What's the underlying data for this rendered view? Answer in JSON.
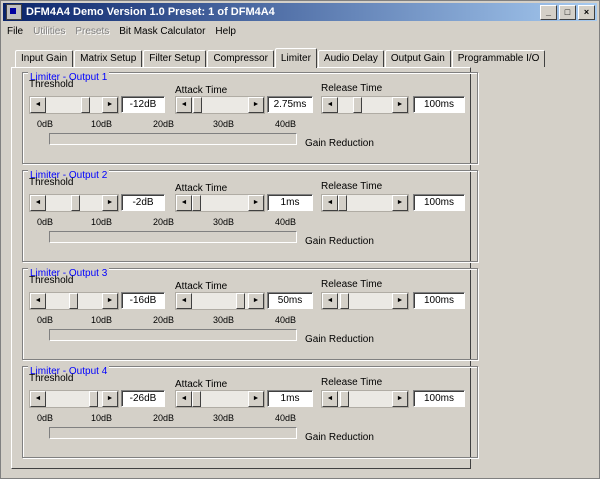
{
  "window": {
    "title": "DFM4A4 Demo Version 1.0 Preset: 1 of DFM4A4",
    "min_label": "_",
    "max_label": "□",
    "close_label": "×"
  },
  "menu": [
    {
      "label": "File",
      "enabled": true
    },
    {
      "label": "Utilities",
      "enabled": false
    },
    {
      "label": "Presets",
      "enabled": false
    },
    {
      "label": "Bit Mask Calculator",
      "enabled": true
    },
    {
      "label": "Help",
      "enabled": true
    }
  ],
  "tabs": [
    {
      "label": "Input Gain"
    },
    {
      "label": "Matrix Setup"
    },
    {
      "label": "Filter Setup"
    },
    {
      "label": "Compressor"
    },
    {
      "label": "Limiter"
    },
    {
      "label": "Audio Delay"
    },
    {
      "label": "Output Gain"
    },
    {
      "label": "Programmable I/O"
    }
  ],
  "active_tab": "Limiter",
  "labels": {
    "threshold": "Threshold",
    "attack_time": "Attack Time",
    "release_time": "Release Time",
    "gain_reduction": "Gain Reduction"
  },
  "meter_ticks": [
    "0dB",
    "10dB",
    "20dB",
    "30dB",
    "40dB"
  ],
  "limiters": [
    {
      "title": "Limiter - Output 1",
      "threshold": "-12dB",
      "threshold_pos": 0.78,
      "attack": "2.75ms",
      "attack_pos": 0.02,
      "release": "100ms",
      "release_pos": 0.35,
      "gain_reduction": 0
    },
    {
      "title": "Limiter - Output 2",
      "threshold": "-2dB",
      "threshold_pos": 0.55,
      "attack": "1ms",
      "attack_pos": 0.0,
      "release": "100ms",
      "release_pos": 0.0,
      "gain_reduction": 0
    },
    {
      "title": "Limiter - Output 3",
      "threshold": "-16dB",
      "threshold_pos": 0.5,
      "attack": "50ms",
      "attack_pos": 0.97,
      "release": "100ms",
      "release_pos": 0.05,
      "gain_reduction": 0
    },
    {
      "title": "Limiter - Output 4",
      "threshold": "-26dB",
      "threshold_pos": 0.95,
      "attack": "1ms",
      "attack_pos": 0.0,
      "release": "100ms",
      "release_pos": 0.05,
      "gain_reduction": 0
    }
  ],
  "icons": {
    "arrow_left": "◄",
    "arrow_right": "►"
  }
}
